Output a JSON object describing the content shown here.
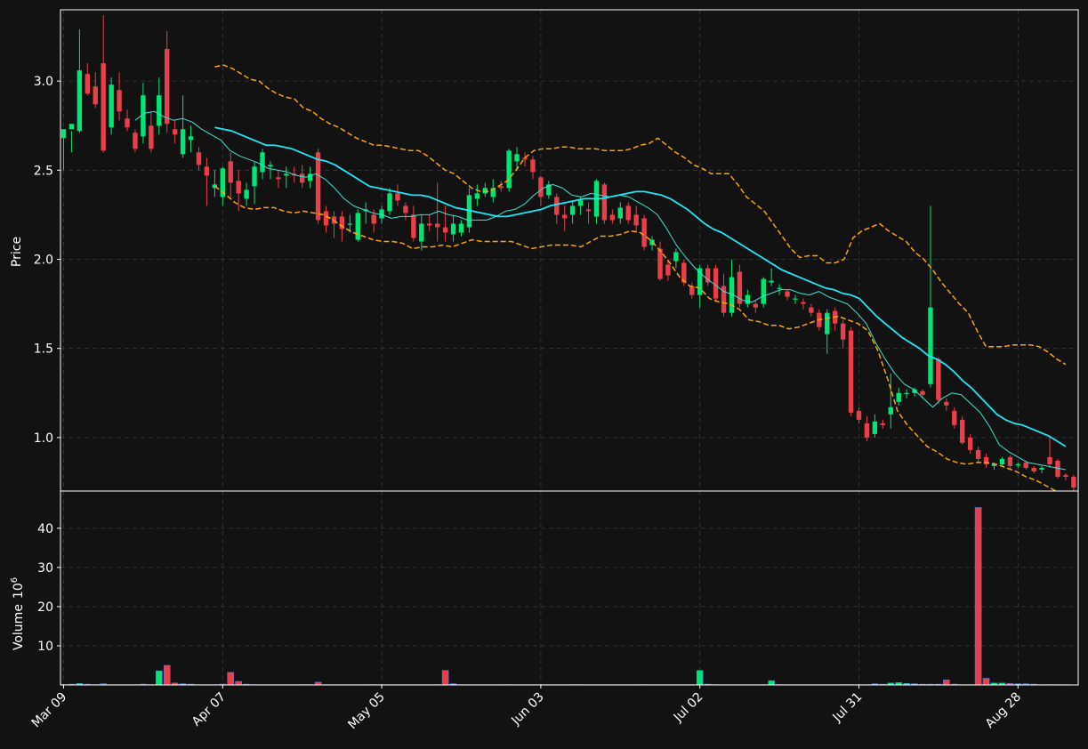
{
  "colors": {
    "background": "#121212",
    "grid": "#3a3a3a",
    "up": "#00e676",
    "down": "#e8404a",
    "ma_thick": "#1de9f5",
    "ma_thin": "#40e0d0",
    "band": "#ffa500",
    "axis": "#ffffff"
  },
  "chart_data": [
    {
      "type": "candlestick",
      "ylabel": "Price",
      "ylim": [
        0.7,
        3.4
      ],
      "yticks": [
        "1.0",
        "1.5",
        "2.0",
        "2.5",
        "3.0"
      ],
      "grid": true,
      "x_tick_labels": [
        "Mar 09",
        "Apr 07",
        "May 05",
        "Jun 03",
        "Jul 02",
        "Jul 31",
        "Aug 28"
      ],
      "x_tick_index": [
        0,
        20,
        40,
        60,
        80,
        100,
        120
      ],
      "n_candles": 127,
      "candles": [
        [
          2.68,
          2.73,
          2.5,
          2.73
        ],
        [
          2.73,
          2.76,
          2.6,
          2.72
        ],
        [
          2.72,
          3.06,
          2.71,
          3.29
        ],
        [
          3.04,
          2.93,
          2.92,
          3.1
        ],
        [
          2.97,
          2.87,
          2.85,
          3.05
        ],
        [
          3.1,
          2.61,
          2.6,
          3.37
        ],
        [
          2.74,
          2.98,
          2.7,
          3.02
        ],
        [
          2.95,
          2.83,
          2.78,
          3.05
        ],
        [
          2.79,
          2.74,
          2.72,
          2.84
        ],
        [
          2.71,
          2.62,
          2.6,
          2.73
        ],
        [
          2.69,
          2.92,
          2.65,
          2.99
        ],
        [
          2.75,
          2.62,
          2.6,
          2.83
        ],
        [
          2.75,
          2.92,
          2.7,
          3.02
        ],
        [
          3.18,
          2.76,
          2.71,
          3.28
        ],
        [
          2.73,
          2.7,
          2.65,
          2.78
        ],
        [
          2.59,
          2.73,
          2.57,
          2.92
        ],
        [
          2.67,
          2.69,
          2.6,
          2.75
        ],
        [
          2.6,
          2.53,
          2.5,
          2.63
        ],
        [
          2.52,
          2.47,
          2.3,
          2.57
        ],
        [
          2.4,
          2.42,
          2.35,
          2.5
        ],
        [
          2.35,
          2.51,
          2.3,
          2.52
        ],
        [
          2.55,
          2.43,
          2.35,
          2.6
        ],
        [
          2.44,
          2.37,
          2.27,
          2.5
        ],
        [
          2.34,
          2.39,
          2.3,
          2.43
        ],
        [
          2.41,
          2.52,
          2.31,
          2.55
        ],
        [
          2.49,
          2.6,
          2.45,
          2.62
        ],
        [
          2.52,
          2.53,
          2.45,
          2.55
        ],
        [
          2.46,
          2.45,
          2.4,
          2.5
        ],
        [
          2.47,
          2.48,
          2.4,
          2.52
        ],
        [
          2.48,
          2.47,
          2.43,
          2.52
        ],
        [
          2.48,
          2.43,
          2.4,
          2.53
        ],
        [
          2.44,
          2.48,
          2.4,
          2.52
        ],
        [
          2.6,
          2.22,
          2.2,
          2.62
        ],
        [
          2.27,
          2.19,
          2.15,
          2.3
        ],
        [
          2.24,
          2.2,
          2.12,
          2.27
        ],
        [
          2.24,
          2.17,
          2.1,
          2.27
        ],
        [
          2.2,
          2.2,
          2.15,
          2.25
        ],
        [
          2.11,
          2.26,
          2.1,
          2.28
        ],
        [
          2.27,
          2.28,
          2.2,
          2.32
        ],
        [
          2.25,
          2.2,
          2.15,
          2.28
        ],
        [
          2.23,
          2.28,
          2.2,
          2.3
        ],
        [
          2.27,
          2.37,
          2.25,
          2.4
        ],
        [
          2.37,
          2.33,
          2.3,
          2.42
        ],
        [
          2.3,
          2.26,
          2.22,
          2.32
        ],
        [
          2.25,
          2.12,
          2.1,
          2.3
        ],
        [
          2.1,
          2.2,
          2.05,
          2.25
        ],
        [
          2.2,
          2.19,
          2.16,
          2.25
        ],
        [
          2.2,
          2.18,
          2.1,
          2.43
        ],
        [
          2.18,
          2.15,
          2.1,
          2.3
        ],
        [
          2.14,
          2.2,
          2.1,
          2.25
        ],
        [
          2.15,
          2.2,
          2.13,
          2.22
        ],
        [
          2.18,
          2.36,
          2.15,
          2.4
        ],
        [
          2.34,
          2.37,
          2.3,
          2.42
        ],
        [
          2.37,
          2.4,
          2.35,
          2.43
        ],
        [
          2.35,
          2.4,
          2.32,
          2.45
        ],
        [
          2.41,
          2.4,
          2.38,
          2.44
        ],
        [
          2.4,
          2.61,
          2.38,
          2.62
        ],
        [
          2.55,
          2.59,
          2.5,
          2.63
        ],
        [
          2.57,
          2.56,
          2.52,
          2.6
        ],
        [
          2.56,
          2.49,
          2.45,
          2.58
        ],
        [
          2.46,
          2.35,
          2.3,
          2.47
        ],
        [
          2.36,
          2.42,
          2.34,
          2.44
        ],
        [
          2.35,
          2.25,
          2.2,
          2.37
        ],
        [
          2.25,
          2.23,
          2.16,
          2.3
        ],
        [
          2.25,
          2.3,
          2.2,
          2.33
        ],
        [
          2.3,
          2.33,
          2.25,
          2.35
        ],
        [
          2.28,
          2.27,
          2.2,
          2.32
        ],
        [
          2.24,
          2.44,
          2.2,
          2.45
        ],
        [
          2.42,
          2.22,
          2.2,
          2.43
        ],
        [
          2.25,
          2.22,
          2.2,
          2.28
        ],
        [
          2.23,
          2.29,
          2.2,
          2.32
        ],
        [
          2.3,
          2.22,
          2.2,
          2.32
        ],
        [
          2.25,
          2.19,
          2.15,
          2.3
        ],
        [
          2.23,
          2.07,
          2.05,
          2.25
        ],
        [
          2.08,
          2.11,
          2.05,
          2.13
        ],
        [
          2.06,
          1.89,
          1.88,
          2.1
        ],
        [
          1.97,
          1.91,
          1.88,
          2.0
        ],
        [
          1.99,
          2.04,
          1.95,
          2.06
        ],
        [
          1.98,
          1.87,
          1.85,
          2.0
        ],
        [
          1.85,
          1.8,
          1.78,
          1.87
        ],
        [
          1.8,
          1.95,
          1.73,
          1.97
        ],
        [
          1.95,
          1.87,
          1.85,
          1.97
        ],
        [
          1.95,
          1.78,
          1.76,
          1.97
        ],
        [
          1.85,
          1.7,
          1.68,
          1.92
        ],
        [
          1.7,
          1.9,
          1.68,
          2.0
        ],
        [
          1.93,
          1.75,
          1.73,
          1.97
        ],
        [
          1.75,
          1.8,
          1.73,
          1.83
        ],
        [
          1.75,
          1.73,
          1.7,
          1.77
        ],
        [
          1.75,
          1.89,
          1.73,
          1.9
        ],
        [
          1.87,
          1.88,
          1.85,
          1.95
        ],
        [
          1.84,
          1.84,
          1.8,
          1.86
        ],
        [
          1.82,
          1.79,
          1.77,
          1.83
        ],
        [
          1.78,
          1.78,
          1.75,
          1.8
        ],
        [
          1.76,
          1.75,
          1.72,
          1.78
        ],
        [
          1.73,
          1.7,
          1.68,
          1.75
        ],
        [
          1.7,
          1.62,
          1.6,
          1.72
        ],
        [
          1.58,
          1.7,
          1.47,
          1.72
        ],
        [
          1.71,
          1.64,
          1.6,
          1.73
        ],
        [
          1.64,
          1.55,
          1.5,
          1.66
        ],
        [
          1.6,
          1.14,
          1.12,
          1.62
        ],
        [
          1.15,
          1.1,
          1.08,
          1.17
        ],
        [
          1.08,
          1.0,
          0.98,
          1.12
        ],
        [
          1.02,
          1.09,
          1.0,
          1.13
        ],
        [
          1.08,
          1.07,
          1.05,
          1.1
        ],
        [
          1.13,
          1.17,
          1.05,
          1.36
        ],
        [
          1.2,
          1.25,
          1.18,
          1.28
        ],
        [
          1.25,
          1.25,
          1.22,
          1.27
        ],
        [
          1.25,
          1.27,
          1.23,
          1.28
        ],
        [
          1.26,
          1.24,
          1.22,
          1.27
        ],
        [
          1.3,
          1.73,
          1.28,
          2.3
        ],
        [
          1.44,
          1.21,
          1.19,
          1.45
        ],
        [
          1.2,
          1.18,
          1.15,
          1.22
        ],
        [
          1.15,
          1.07,
          1.05,
          1.17
        ],
        [
          1.1,
          0.97,
          0.96,
          1.12
        ],
        [
          1.0,
          0.93,
          0.91,
          1.02
        ],
        [
          0.93,
          0.88,
          0.86,
          0.95
        ],
        [
          0.89,
          0.85,
          0.83,
          0.91
        ],
        [
          0.84,
          0.85,
          0.82,
          0.86
        ],
        [
          0.85,
          0.88,
          0.84,
          0.89
        ],
        [
          0.89,
          0.84,
          0.82,
          0.9
        ],
        [
          0.85,
          0.85,
          0.83,
          0.86
        ],
        [
          0.86,
          0.83,
          0.82,
          0.87
        ],
        [
          0.83,
          0.81,
          0.8,
          0.84
        ],
        [
          0.82,
          0.83,
          0.8,
          0.84
        ],
        [
          0.89,
          0.85,
          0.83,
          1.0
        ],
        [
          0.87,
          0.78,
          0.77,
          0.88
        ],
        [
          0.79,
          0.78,
          0.76,
          0.8
        ],
        [
          0.78,
          0.72,
          0.7,
          0.79
        ]
      ],
      "moving_average_thick": [
        2.74,
        2.73,
        2.72,
        2.7,
        2.68,
        2.66,
        2.64,
        2.64,
        2.63,
        2.62,
        2.6,
        2.58,
        2.56,
        2.55,
        2.53,
        2.5,
        2.47,
        2.44,
        2.41,
        2.4,
        2.39,
        2.38,
        2.37,
        2.36,
        2.36,
        2.35,
        2.33,
        2.31,
        2.29,
        2.28,
        2.27,
        2.26,
        2.25,
        2.24,
        2.24,
        2.25,
        2.26,
        2.27,
        2.28,
        2.3,
        2.31,
        2.32,
        2.33,
        2.34,
        2.34,
        2.34,
        2.35,
        2.36,
        2.37,
        2.38,
        2.38,
        2.37,
        2.36,
        2.34,
        2.31,
        2.28,
        2.24,
        2.2,
        2.17,
        2.15,
        2.12,
        2.09,
        2.06,
        2.03,
        2.0,
        1.97,
        1.94,
        1.92,
        1.9,
        1.88,
        1.86,
        1.84,
        1.83,
        1.81,
        1.8,
        1.78,
        1.73,
        1.68,
        1.64,
        1.6,
        1.56,
        1.53,
        1.5,
        1.46,
        1.44,
        1.41,
        1.37,
        1.32,
        1.28,
        1.23,
        1.18,
        1.13,
        1.1,
        1.08,
        1.07,
        1.05,
        1.03,
        1.01,
        0.98,
        0.95
      ],
      "moving_average_thick_start": 19,
      "moving_average_thin": [
        2.78,
        2.82,
        2.83,
        2.8,
        2.78,
        2.79,
        2.77,
        2.73,
        2.7,
        2.67,
        2.61,
        2.58,
        2.56,
        2.54,
        2.51,
        2.5,
        2.49,
        2.47,
        2.46,
        2.48,
        2.45,
        2.4,
        2.34,
        2.3,
        2.28,
        2.26,
        2.25,
        2.23,
        2.24,
        2.24,
        2.25,
        2.25,
        2.27,
        2.25,
        2.24,
        2.22,
        2.22,
        2.22,
        2.24,
        2.27,
        2.28,
        2.31,
        2.36,
        2.4,
        2.42,
        2.4,
        2.36,
        2.35,
        2.37,
        2.36,
        2.35,
        2.36,
        2.35,
        2.32,
        2.29,
        2.25,
        2.17,
        2.08,
        2.01,
        1.95,
        1.9,
        1.86,
        1.82,
        1.8,
        1.77,
        1.76,
        1.79,
        1.81,
        1.83,
        1.83,
        1.81,
        1.8,
        1.82,
        1.79,
        1.77,
        1.75,
        1.7,
        1.64,
        1.53,
        1.44,
        1.36,
        1.3,
        1.27,
        1.22,
        1.17,
        1.22,
        1.25,
        1.24,
        1.19,
        1.14,
        1.06,
        0.96,
        0.92,
        0.89,
        0.86,
        0.85,
        0.84,
        0.83,
        0.82
      ],
      "moving_average_thin_start": 9,
      "band_upper": [
        3.08,
        3.09,
        3.07,
        3.04,
        3.01,
        3.0,
        2.96,
        2.93,
        2.91,
        2.9,
        2.85,
        2.83,
        2.79,
        2.76,
        2.74,
        2.71,
        2.68,
        2.66,
        2.64,
        2.64,
        2.63,
        2.62,
        2.61,
        2.61,
        2.58,
        2.54,
        2.5,
        2.48,
        2.44,
        2.4,
        2.38,
        2.38,
        2.41,
        2.44,
        2.5,
        2.57,
        2.61,
        2.62,
        2.62,
        2.63,
        2.63,
        2.62,
        2.62,
        2.62,
        2.61,
        2.61,
        2.61,
        2.62,
        2.64,
        2.65,
        2.68,
        2.64,
        2.6,
        2.57,
        2.53,
        2.51,
        2.48,
        2.48,
        2.48,
        2.42,
        2.35,
        2.31,
        2.27,
        2.2,
        2.13,
        2.06,
        2.01,
        2.02,
        2.02,
        1.98,
        1.98,
        2.0,
        2.12,
        2.16,
        2.18,
        2.2,
        2.16,
        2.13,
        2.1,
        2.04,
        2.0,
        1.94,
        1.87,
        1.81,
        1.75,
        1.7,
        1.6,
        1.51,
        1.51,
        1.51,
        1.52,
        1.52,
        1.52,
        1.51,
        1.48,
        1.44,
        1.41
      ],
      "band_upper_start": 19,
      "band_lower": [
        2.41,
        2.37,
        2.32,
        2.29,
        2.28,
        2.29,
        2.29,
        2.27,
        2.26,
        2.27,
        2.26,
        2.25,
        2.22,
        2.18,
        2.15,
        2.13,
        2.11,
        2.1,
        2.1,
        2.09,
        2.06,
        2.07,
        2.07,
        2.08,
        2.07,
        2.09,
        2.11,
        2.1,
        2.1,
        2.1,
        2.1,
        2.08,
        2.06,
        2.07,
        2.08,
        2.08,
        2.08,
        2.07,
        2.1,
        2.13,
        2.13,
        2.14,
        2.16,
        2.15,
        2.11,
        2.05,
        1.98,
        1.9,
        1.85,
        1.84,
        1.78,
        1.76,
        1.75,
        1.72,
        1.66,
        1.65,
        1.63,
        1.63,
        1.61,
        1.62,
        1.64,
        1.66,
        1.67,
        1.68,
        1.66,
        1.64,
        1.6,
        1.49,
        1.33,
        1.15,
        1.07,
        1.01,
        0.95,
        0.92,
        0.88,
        0.86,
        0.85,
        0.86,
        0.86,
        0.85,
        0.83,
        0.81,
        0.78,
        0.76,
        0.73,
        0.7,
        0.68
      ],
      "band_lower_start": 19
    },
    {
      "type": "bar",
      "ylabel": "Volume",
      "ylabel_exponent": "10",
      "ylabel_exponent_power": "6",
      "ylim": [
        0,
        49.5
      ],
      "yticks": [
        "10",
        "20",
        "30",
        "40"
      ],
      "grid": true,
      "volume_millions": [
        0.1,
        0.2,
        0.4,
        0.2,
        0.1,
        0.3,
        0.1,
        0.1,
        0.1,
        0.1,
        0.2,
        0.1,
        3.6,
        5,
        0.5,
        0.3,
        0.2,
        0.1,
        0.1,
        0.1,
        0.2,
        3.2,
        0.9,
        0.2,
        0.1,
        0.1,
        0.1,
        0.1,
        0.1,
        0.1,
        0.1,
        0.1,
        0.7,
        0.1,
        0.1,
        0.1,
        0.1,
        0.1,
        0.1,
        0.1,
        0.1,
        0.1,
        0.1,
        0.1,
        0.1,
        0.1,
        0.1,
        0.1,
        3.7,
        0.3,
        0.1,
        0.1,
        0.1,
        0.1,
        0.1,
        0.1,
        0.1,
        0.1,
        0.1,
        0.1,
        0.1,
        0.1,
        0.1,
        0.1,
        0.1,
        0.1,
        0.1,
        0.1,
        0.1,
        0.1,
        0.1,
        0.1,
        0.1,
        0.1,
        0.1,
        0.1,
        0.1,
        0.1,
        0.1,
        0.1,
        3.7,
        0.2,
        0.1,
        0.1,
        0.1,
        0.1,
        0.1,
        0.1,
        0.1,
        1.1,
        0.1,
        0.1,
        0.1,
        0.1,
        0.1,
        0.1,
        0.1,
        0.1,
        0.1,
        0.1,
        0.1,
        0.1,
        0.3,
        0.2,
        0.5,
        0.6,
        0.4,
        0.3,
        0.2,
        0.2,
        0.2,
        1.3,
        0.2,
        0.1,
        0.1,
        45.3,
        1.7,
        0.5,
        0.5,
        0.4,
        0.3,
        0.3,
        0.2,
        0.1,
        0.1,
        0.1,
        0.1
      ]
    }
  ]
}
